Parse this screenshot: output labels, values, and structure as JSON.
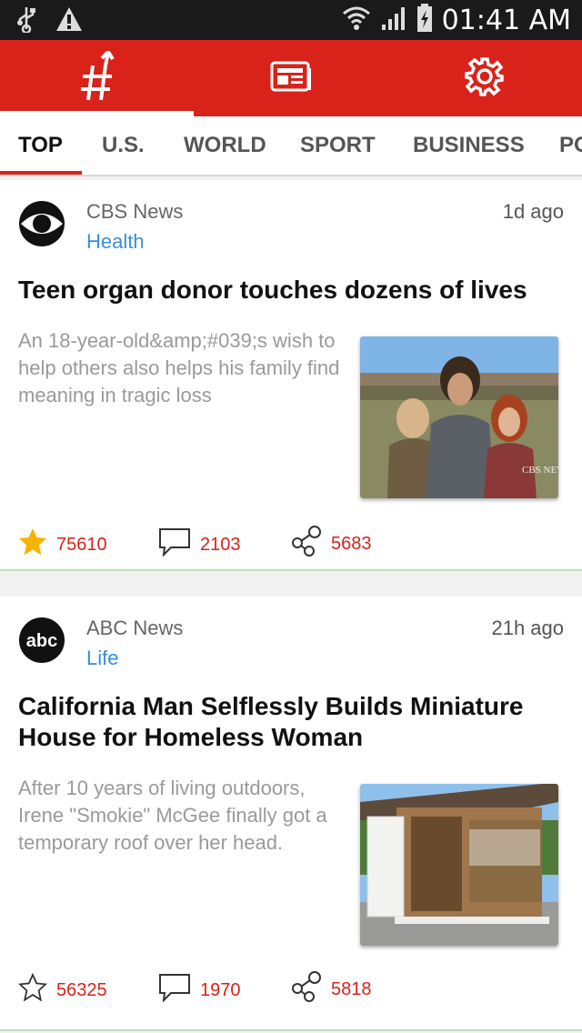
{
  "status_bar": {
    "time": "01:41 AM",
    "icons": [
      "usb-icon",
      "warning-icon",
      "wifi-icon",
      "signal-icon",
      "battery-charging-icon"
    ]
  },
  "app_bar": {
    "tabs": [
      {
        "icon": "hashtag-icon",
        "selected": true
      },
      {
        "icon": "newspaper-icon",
        "selected": false
      },
      {
        "icon": "gear-icon",
        "selected": false
      }
    ],
    "color": "#d9221a"
  },
  "categories": {
    "items": [
      "TOP",
      "U.S.",
      "WORLD",
      "SPORT",
      "BUSINESS",
      "PO"
    ],
    "active": "TOP"
  },
  "articles": [
    {
      "source": "CBS News",
      "section": "Health",
      "time_ago": "1d ago",
      "headline": "Teen organ donor touches dozens of lives",
      "summary": "An 18-year-old&amp;#039;s wish to help others also helps his family find meaning in tragic loss",
      "image_watermark": "CBS NEWS",
      "stats": {
        "likes": "75610",
        "comments": "2103",
        "shares": "5683"
      },
      "liked": true
    },
    {
      "source": "ABC News",
      "section": "Life",
      "time_ago": "21h ago",
      "headline": "California Man Selflessly Builds Miniature House for Homeless Woman",
      "summary": "After 10 years of living outdoors, Irene \"Smokie\" McGee finally got a temporary roof over her head.",
      "logo_text": "abc",
      "stats": {
        "likes": "56325",
        "comments": "1970",
        "shares": "5818"
      },
      "liked": false
    }
  ],
  "colors": {
    "accent": "#d9221a",
    "link": "#3a8ed8",
    "star": "#f4b400"
  }
}
